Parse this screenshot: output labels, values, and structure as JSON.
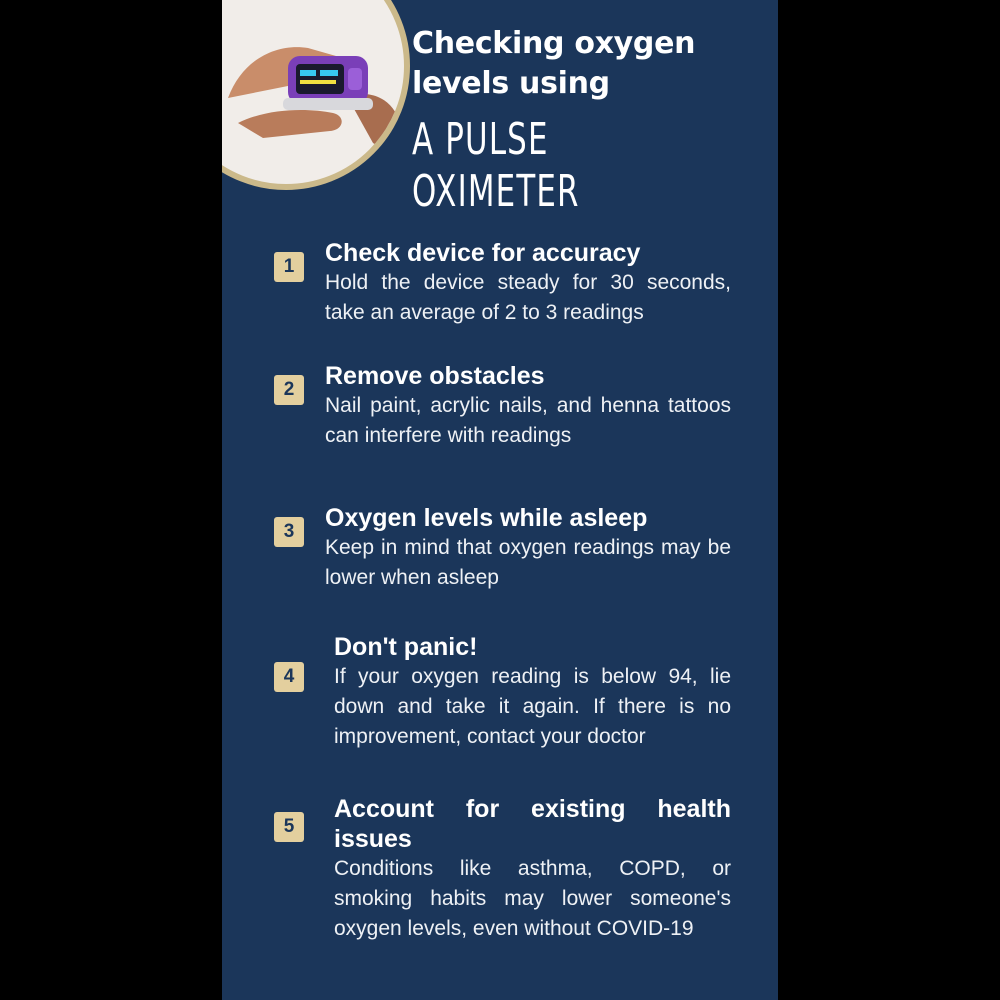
{
  "poster": {
    "background": "#1b365a",
    "badge_color": "#e3cf9e",
    "photo_frame_color": "#cbb98a"
  },
  "title": {
    "line1": "Checking oxygen",
    "line2": "levels using",
    "line3": "A PULSE OXIMETER"
  },
  "photo": {
    "icon": "pulse-oximeter-on-finger-photo"
  },
  "steps": [
    {
      "number": "1",
      "heading": "Check device for accuracy",
      "body": "Hold the device steady for 30 seconds, take an average of 2  to 3 readings"
    },
    {
      "number": "2",
      "heading": "Remove obstacles",
      "body": "Nail paint, acrylic nails, and henna tattoos can interfere with readings"
    },
    {
      "number": "3",
      "heading": "Oxygen levels while asleep",
      "body": "Keep in mind that oxygen readings may be lower when asleep"
    },
    {
      "number": "4",
      "heading": "Don't panic!",
      "body": "If your oxygen reading is below 94, lie down and take it again. If there is no improvement, contact your doctor"
    },
    {
      "number": "5",
      "heading": "Account for existing health issues",
      "body": "Conditions like asthma, COPD, or smoking habits may lower someone's oxygen levels, even without COVID-19"
    }
  ]
}
